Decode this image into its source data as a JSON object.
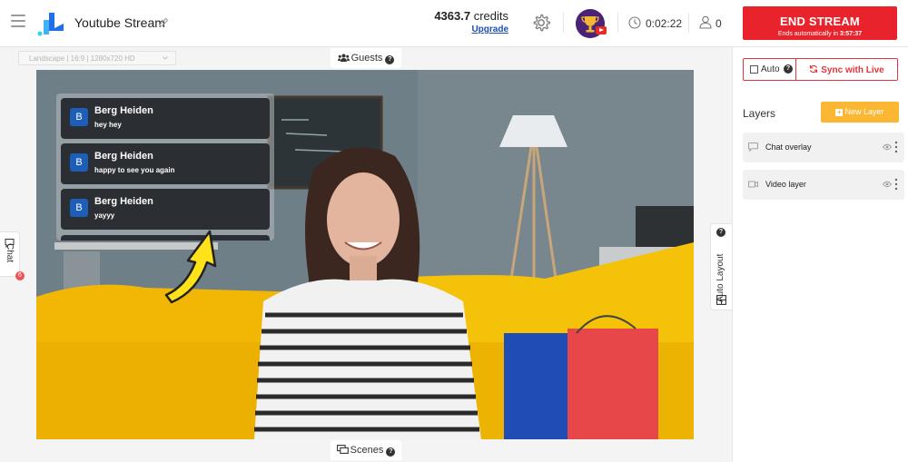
{
  "header": {
    "app_title": "Youtube Stream",
    "credits_value": "4363.7",
    "credits_label": "credits",
    "upgrade_label": "Upgrade",
    "timer": "0:02:22",
    "viewers": "0",
    "end_stream_label": "END STREAM",
    "end_stream_sub": "Ends automatically in",
    "end_stream_time": "3:57:37"
  },
  "canvas": {
    "format_select": "Landscape | 16:9 | 1280x720 HD",
    "guests_label": "Guests",
    "scenes_label": "Scenes",
    "chat_tab_label": "Chat",
    "chat_badge": "6",
    "auto_layout_label": "Auto Layout",
    "chat_messages": [
      {
        "avatar": "B",
        "name": "Berg Heiden",
        "text": "hey hey"
      },
      {
        "avatar": "B",
        "name": "Berg Heiden",
        "text": "happy to see you again"
      },
      {
        "avatar": "B",
        "name": "Berg Heiden",
        "text": "yayyy"
      }
    ]
  },
  "right_panel": {
    "auto_label": "Auto",
    "sync_label": "Sync with Live",
    "layers_title": "Layers",
    "new_layer_label": "New Layer",
    "layers": [
      {
        "name": "Chat overlay",
        "icon": "chat-bubble-icon"
      },
      {
        "name": "Video layer",
        "icon": "video-camera-icon"
      }
    ]
  },
  "colors": {
    "end_stream": "#e8232b",
    "new_layer": "#fbb731",
    "link": "#1a4fb5",
    "chat_card": "#2b2e33",
    "avatar_badge": "#1d5fb8"
  }
}
